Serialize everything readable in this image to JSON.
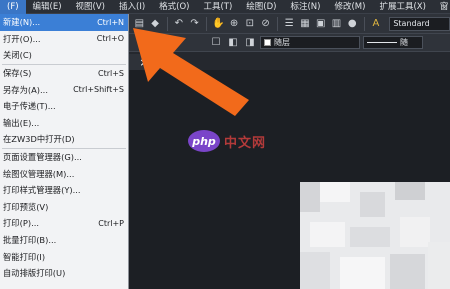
{
  "menubar": {
    "items": [
      {
        "label": "(F)",
        "active": true
      },
      {
        "label": "编辑(E)",
        "active": false
      },
      {
        "label": "视图(V)",
        "active": false
      },
      {
        "label": "插入(I)",
        "active": false
      },
      {
        "label": "格式(O)",
        "active": false
      },
      {
        "label": "工具(T)",
        "active": false
      },
      {
        "label": "绘图(D)",
        "active": false
      },
      {
        "label": "标注(N)",
        "active": false
      },
      {
        "label": "修改(M)",
        "active": false
      },
      {
        "label": "扩展工具(X)",
        "active": false
      },
      {
        "label": "窗",
        "active": false
      }
    ]
  },
  "file_menu": {
    "items": [
      {
        "label": "新建(N)...",
        "shortcut": "Ctrl+N",
        "highlighted": true
      },
      {
        "label": "打开(O)...",
        "shortcut": "Ctrl+O"
      },
      {
        "label": "关闭(C)",
        "shortcut": ""
      },
      {
        "label": "保存(S)",
        "shortcut": "Ctrl+S"
      },
      {
        "label": "另存为(A)...",
        "shortcut": "Ctrl+Shift+S"
      },
      {
        "label": "电子传递(T)...",
        "shortcut": ""
      },
      {
        "label": "输出(E)...",
        "shortcut": ""
      },
      {
        "label": "在ZW3D中打开(D)",
        "shortcut": ""
      },
      {
        "label": "页面设置管理器(G)...",
        "shortcut": ""
      },
      {
        "label": "绘图仪管理器(M)...",
        "shortcut": ""
      },
      {
        "label": "打印样式管理器(Y)...",
        "shortcut": ""
      },
      {
        "label": "打印预览(V)",
        "shortcut": ""
      },
      {
        "label": "打印(P)...",
        "shortcut": "Ctrl+P"
      },
      {
        "label": "批量打印(B)...",
        "shortcut": ""
      },
      {
        "label": "智能打印(I)",
        "shortcut": ""
      },
      {
        "label": "自动排版打印(U)",
        "shortcut": ""
      }
    ]
  },
  "toolbar": {
    "text_style_value": "Standard"
  },
  "toolbar2": {
    "layer_value": "随层",
    "linetype_value": "随"
  },
  "tabs": {
    "close_glyph": "×"
  },
  "watermark": {
    "logo_text": "php",
    "site_text": "中文网"
  },
  "colors": {
    "menu_highlight": "#3b7fd6",
    "arrow": "#f26a1b",
    "canvas": "#1c1f24"
  }
}
